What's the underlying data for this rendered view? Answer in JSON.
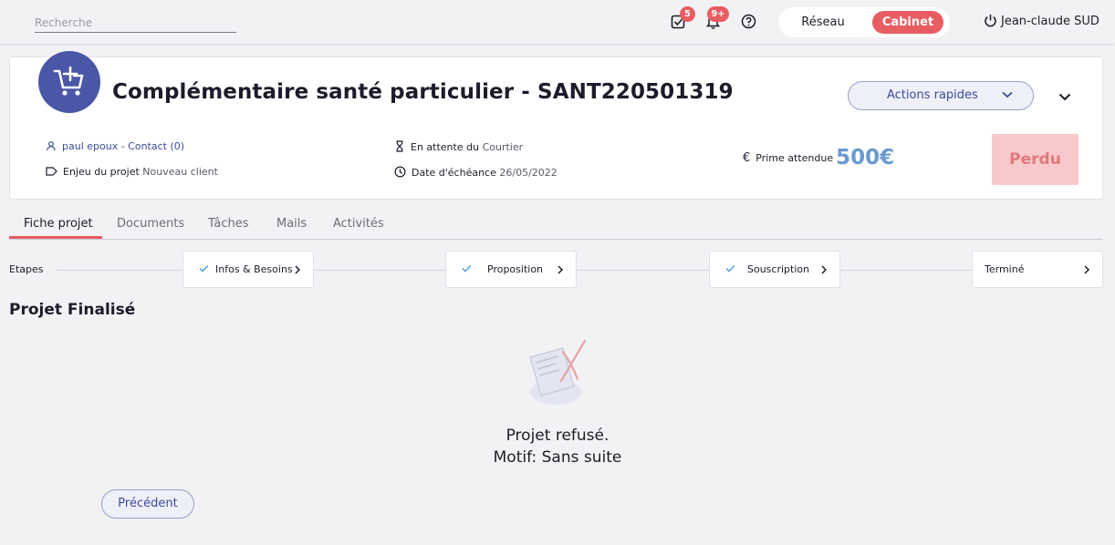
{
  "topbar": {
    "search_placeholder": "Recherche",
    "tasks_badge": "5",
    "notifications_badge": "9+",
    "toggle": {
      "left": "Réseau",
      "right": "Cabinet",
      "active": "Cabinet"
    },
    "user_name": "Jean-claude SUD"
  },
  "project": {
    "title": "Complémentaire santé particulier - SANT220501319",
    "quick_actions": "Actions rapides",
    "contact": "paul epoux - Contact (0)",
    "enjeu_label": "Enjeu du projet",
    "enjeu_value": "Nouveau client",
    "attente_label": "En attente du",
    "attente_value": "Courtier",
    "echeance_label": "Date d'échéance",
    "echeance_value": "26/05/2022",
    "prime_label": "Prime attendue",
    "prime_value": "500€",
    "status": "Perdu"
  },
  "tabs": [
    {
      "label": "Fiche projet",
      "active": true
    },
    {
      "label": "Documents"
    },
    {
      "label": "Tâches"
    },
    {
      "label": "Mails"
    },
    {
      "label": "Activités"
    }
  ],
  "steps": {
    "label": "Etapes",
    "items": [
      {
        "label": "Infos & Besoins",
        "done": true
      },
      {
        "label": "Proposition",
        "done": true
      },
      {
        "label": "Souscription",
        "done": true
      },
      {
        "label": "Terminé",
        "done": false
      }
    ]
  },
  "content": {
    "section_title": "Projet Finalisé",
    "refused_line1": "Projet refusé.",
    "refused_line2": "Motif: Sans suite",
    "previous_button": "Précédent"
  },
  "colors": {
    "accent_red": "#e85d62",
    "primary_blue": "#4a56a6",
    "prime_blue": "#6b9ad0",
    "lost_bg": "#f8c9cb"
  }
}
